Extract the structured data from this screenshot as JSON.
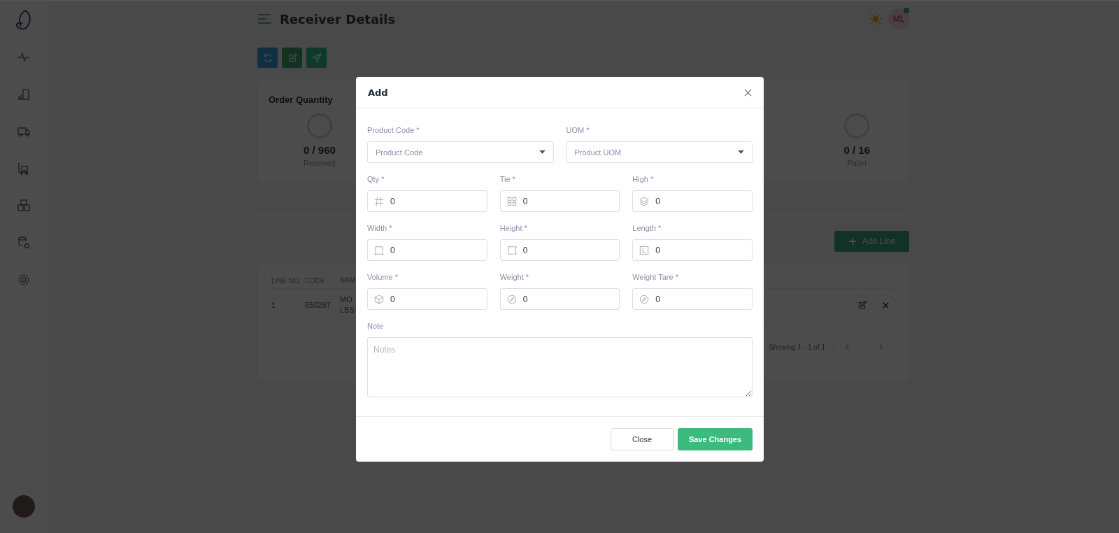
{
  "header": {
    "title": "Receiver Details",
    "avatar_initials": "ML",
    "online": true
  },
  "stats_card": {
    "title": "Order Quantity",
    "stats": [
      {
        "value": "0 / 960",
        "label": "Received"
      },
      {
        "value": "0 / 16",
        "label": "Pallet"
      }
    ]
  },
  "add_line_button": "Add Line",
  "table": {
    "columns": [
      "LINE NO",
      "CODE",
      "NAM"
    ],
    "rows": [
      {
        "cells": [
          "1",
          "650287",
          "MO LBS"
        ]
      }
    ]
  },
  "pagination": {
    "summary": "Showing 1 - 1 of 1"
  },
  "modal": {
    "title": "Add",
    "selects": [
      {
        "label": "Product Code *",
        "placeholder": "Product Code"
      },
      {
        "label": "UOM *",
        "placeholder": "Product UOM"
      }
    ],
    "number_fields": [
      {
        "label": "Qty *",
        "value": "0"
      },
      {
        "label": "Tie *",
        "value": "0"
      },
      {
        "label": "High *",
        "value": "0"
      },
      {
        "label": "Width *",
        "value": "0"
      },
      {
        "label": "Height *",
        "value": "0"
      },
      {
        "label": "Length *",
        "value": "0"
      },
      {
        "label": "Volume *",
        "value": "0"
      },
      {
        "label": "Weight *",
        "value": "0"
      },
      {
        "label": "Weight Tare *",
        "value": "0"
      }
    ],
    "note": {
      "label": "Note",
      "placeholder": "Notes"
    },
    "buttons": [
      {
        "label": "Close",
        "kind": "secondary"
      },
      {
        "label": "Save Changes",
        "kind": "primary"
      }
    ]
  }
}
